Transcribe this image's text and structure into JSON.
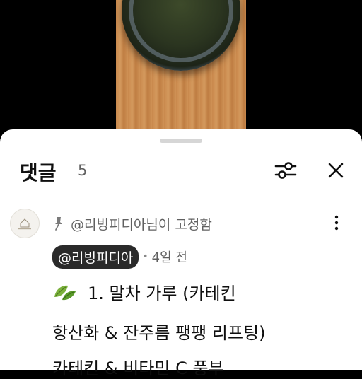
{
  "sheet": {
    "title": "댓글",
    "count": "5"
  },
  "comment": {
    "pinned_text": "@리빙피디아님이 고정함",
    "author": "@리빙피디아",
    "separator": "•",
    "time": "4일 전",
    "body": {
      "line1": "1. 말차 가루 (카테킨",
      "line2": "항산화 & 잔주름 팽팽 리프팅)",
      "line3": "카테킨 & 비타민 C 풍부"
    }
  },
  "icons": {
    "filter": "sliders-icon",
    "close": "close-icon",
    "more": "more-vertical-icon",
    "pin": "pin-icon",
    "leaf": "leaf-icon"
  }
}
